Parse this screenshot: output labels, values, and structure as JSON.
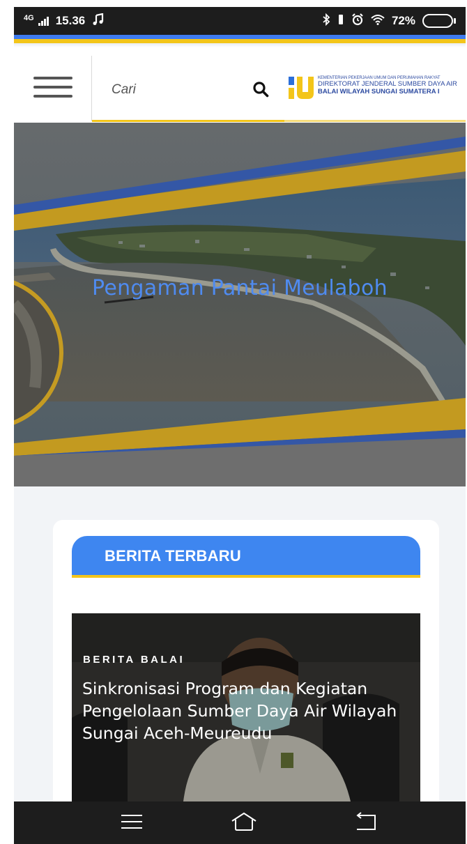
{
  "status_bar": {
    "network": "4G",
    "time": "15.36",
    "battery": "72%",
    "battery_level": 0.72,
    "icons": [
      "signal-icon",
      "music-icon",
      "bluetooth-icon",
      "vibrate-icon",
      "alarm-icon",
      "wifi-icon",
      "battery-icon"
    ]
  },
  "header": {
    "search_placeholder": "Cari",
    "logo": {
      "line1": "KEMENTERIAN PEKERJAAN UMUM DAN PERUMAHAN RAKYAT",
      "line2": "DIREKTORAT JENDERAL SUMBER DAYA AIR",
      "line3": "BALAI WILAYAH SUNGAI SUMATERA I"
    },
    "icons": [
      "hamburger-menu-icon",
      "search-icon",
      "pu-logo"
    ]
  },
  "hero": {
    "title": "Pengaman Pantai Meulaboh"
  },
  "section": {
    "title": "BERITA TERBARU"
  },
  "news": {
    "category": "BERITA BALAI",
    "title": "Sinkronisasi Program dan Kegiatan Pengelolaan Sumber Daya Air Wilayah Sungai Aceh-Meureudu"
  },
  "nav_bar": {
    "icons": [
      "recent-apps-icon",
      "home-icon",
      "back-icon"
    ]
  },
  "colors": {
    "accent_blue": "#3e86f0",
    "accent_gold": "#f3c51a",
    "hero_title": "#4f8bf0",
    "system_bar": "#1d1d1d"
  }
}
